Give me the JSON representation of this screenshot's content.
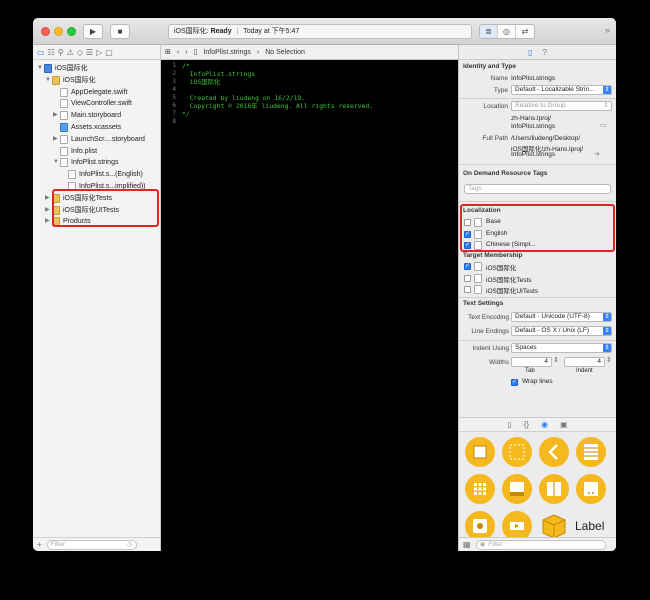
{
  "window": {
    "status_project": "iOS国际化:",
    "status_state": "Ready",
    "status_time": "Today at 下午5:47"
  },
  "navigator": {
    "tree": [
      {
        "label": "iOS国际化",
        "icon": "project-icon",
        "disclosure": "▼"
      },
      {
        "label": "iOS国际化",
        "icon": "folder-icon",
        "disclosure": "▼"
      },
      {
        "label": "AppDelegate.swift",
        "icon": "swift-file-icon",
        "disclosure": ""
      },
      {
        "label": "ViewController.swift",
        "icon": "swift-file-icon",
        "disclosure": ""
      },
      {
        "label": "Main.storyboard",
        "icon": "storyboard-icon",
        "disclosure": "▶"
      },
      {
        "label": "Assets.xcassets",
        "icon": "assets-icon",
        "disclosure": ""
      },
      {
        "label": "LaunchScr....storyboard",
        "icon": "storyboard-icon",
        "disclosure": "▶"
      },
      {
        "label": "Info.plist",
        "icon": "plist-icon",
        "disclosure": ""
      },
      {
        "label": "InfoPlist.strings",
        "icon": "strings-file-icon",
        "disclosure": "▼"
      },
      {
        "label": "InfoPlist.s...(English)",
        "icon": "strings-file-icon",
        "disclosure": ""
      },
      {
        "label": "InfoPlist.s...implified))",
        "icon": "strings-file-icon",
        "disclosure": ""
      },
      {
        "label": "iOS国际化Tests",
        "icon": "folder-icon",
        "disclosure": "▶"
      },
      {
        "label": "iOS国际化UITests",
        "icon": "folder-icon",
        "disclosure": "▶"
      },
      {
        "label": "Products",
        "icon": "folder-icon",
        "disclosure": "▶"
      }
    ],
    "filter_placeholder": "Filter"
  },
  "editor": {
    "jumpbar_file": "InfoPlist.strings",
    "jumpbar_selection": "No Selection",
    "line_numbers": [
      "1",
      "2",
      "3",
      "4",
      "5",
      "6",
      "7",
      "8"
    ],
    "lines": [
      "/*",
      "  InfoPlist.strings",
      "  iOS国际化",
      "",
      "  Created by liudeng on 16/2/19.",
      "  Copyright © 2016年 liudeng. All rights reserved.",
      "*/",
      ""
    ]
  },
  "inspector": {
    "identity_header": "Identity and Type",
    "name_label": "Name",
    "name_value": "InfoPlist.strings",
    "type_label": "Type",
    "type_value": "Default - Localizable Strin...",
    "location_label": "Location",
    "location_value": "Relative to Group",
    "location_path": [
      "zh-Hans.lproj/",
      "InfoPlist.strings"
    ],
    "fullpath_label": "Full Path",
    "fullpath_value": [
      "/Users/liudeng/Desktop/",
      "iOS国际化/zh-Hans.lproj/",
      "InfoPlist.strings"
    ],
    "odr_header": "On Demand Resource Tags",
    "tags_placeholder": "Tags",
    "localization_header": "Localization",
    "localizations": [
      {
        "label": "Base",
        "checked": false
      },
      {
        "label": "English",
        "checked": true
      },
      {
        "label": "Chinese (Simpl...",
        "checked": true
      }
    ],
    "target_header": "Target Membership",
    "targets": [
      {
        "label": "iOS国际化",
        "checked": true
      },
      {
        "label": "iOS国际化Tests",
        "checked": false
      },
      {
        "label": "iOS国际化UITests",
        "checked": false
      }
    ],
    "text_settings_header": "Text Settings",
    "encoding_label": "Text Encoding",
    "encoding_value": "Default - Unicode (UTF-8)",
    "endings_label": "Line Endings",
    "endings_value": "Default - OS X / Unix (LF)",
    "indent_label": "Indent Using",
    "indent_value": "Spaces",
    "widths_label": "Widths",
    "tab_value": "4",
    "indent_width_value": "4",
    "tab_caption": "Tab",
    "indent_caption": "Indent",
    "wrap_label": "Wrap lines",
    "library_label_tile": "Label",
    "library_filter_placeholder": "Filter"
  },
  "colors": {
    "highlight": "#e02525",
    "accent": "#2f7bf0",
    "code_green": "#3ec43a",
    "tile_yellow": "#f5b81f"
  }
}
